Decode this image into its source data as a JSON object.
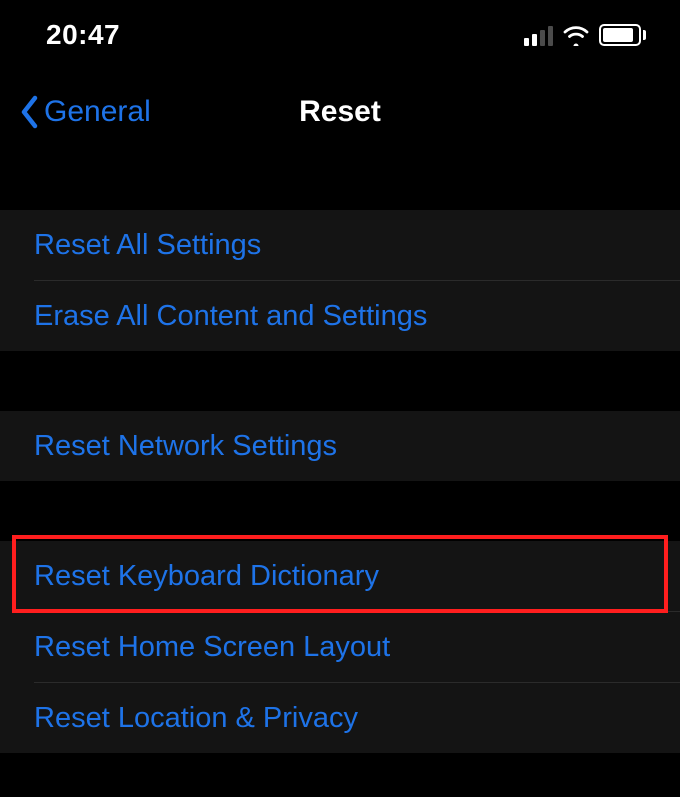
{
  "status": {
    "time": "20:47"
  },
  "nav": {
    "back_label": "General",
    "title": "Reset"
  },
  "group1": {
    "items": [
      {
        "label": "Reset All Settings"
      },
      {
        "label": "Erase All Content and Settings"
      }
    ]
  },
  "group2": {
    "items": [
      {
        "label": "Reset Network Settings"
      }
    ]
  },
  "group3": {
    "items": [
      {
        "label": "Reset Keyboard Dictionary"
      },
      {
        "label": "Reset Home Screen Layout"
      },
      {
        "label": "Reset Location & Privacy"
      }
    ]
  },
  "highlight_index": 0
}
